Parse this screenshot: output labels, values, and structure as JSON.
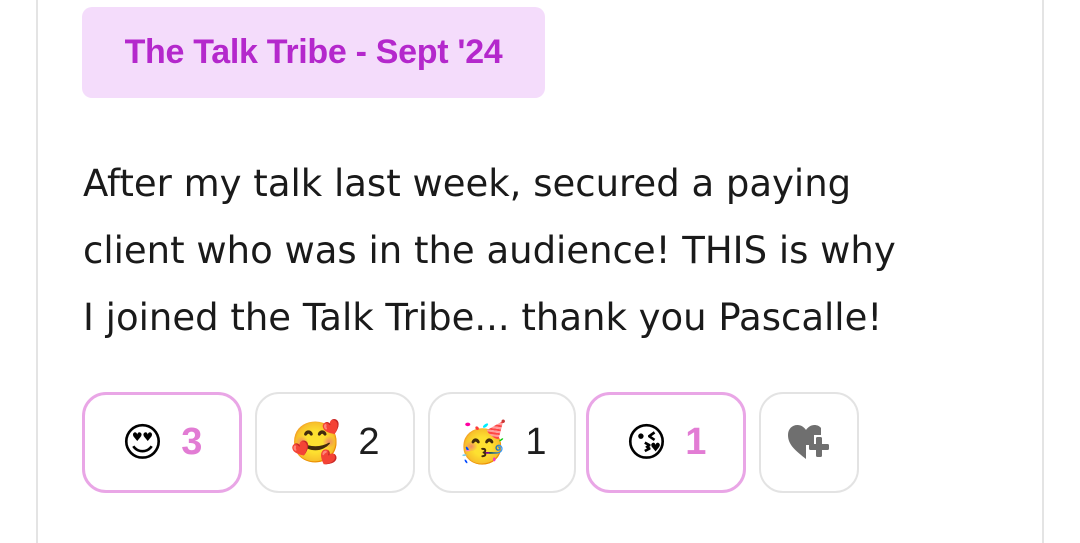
{
  "post": {
    "tag": "The Talk Tribe - Sept '24",
    "text_lines": [
      "After my talk last week, secured a paying",
      "client who was in the audience! THIS is why",
      "I joined the Talk Tribe... thank you Pascalle!"
    ]
  },
  "reactions": [
    {
      "emoji": "😍",
      "icon": "heart-eyes-emoji-icon",
      "count": "3",
      "active": true
    },
    {
      "emoji": "🥰",
      "icon": "smiling-face-with-hearts-emoji-icon",
      "count": "2",
      "active": false
    },
    {
      "emoji": "🥳",
      "icon": "party-face-emoji-icon",
      "count": "1",
      "active": false
    },
    {
      "emoji": "😘",
      "icon": "face-blowing-kiss-emoji-icon",
      "count": "1",
      "active": true
    }
  ],
  "add_reaction_icon": "add-reaction-heart-icon",
  "colors": {
    "tag_background": "#f4dcfb",
    "tag_text": "#b428cc",
    "active_border": "#e9a6e6",
    "active_count": "#e27cd4"
  }
}
